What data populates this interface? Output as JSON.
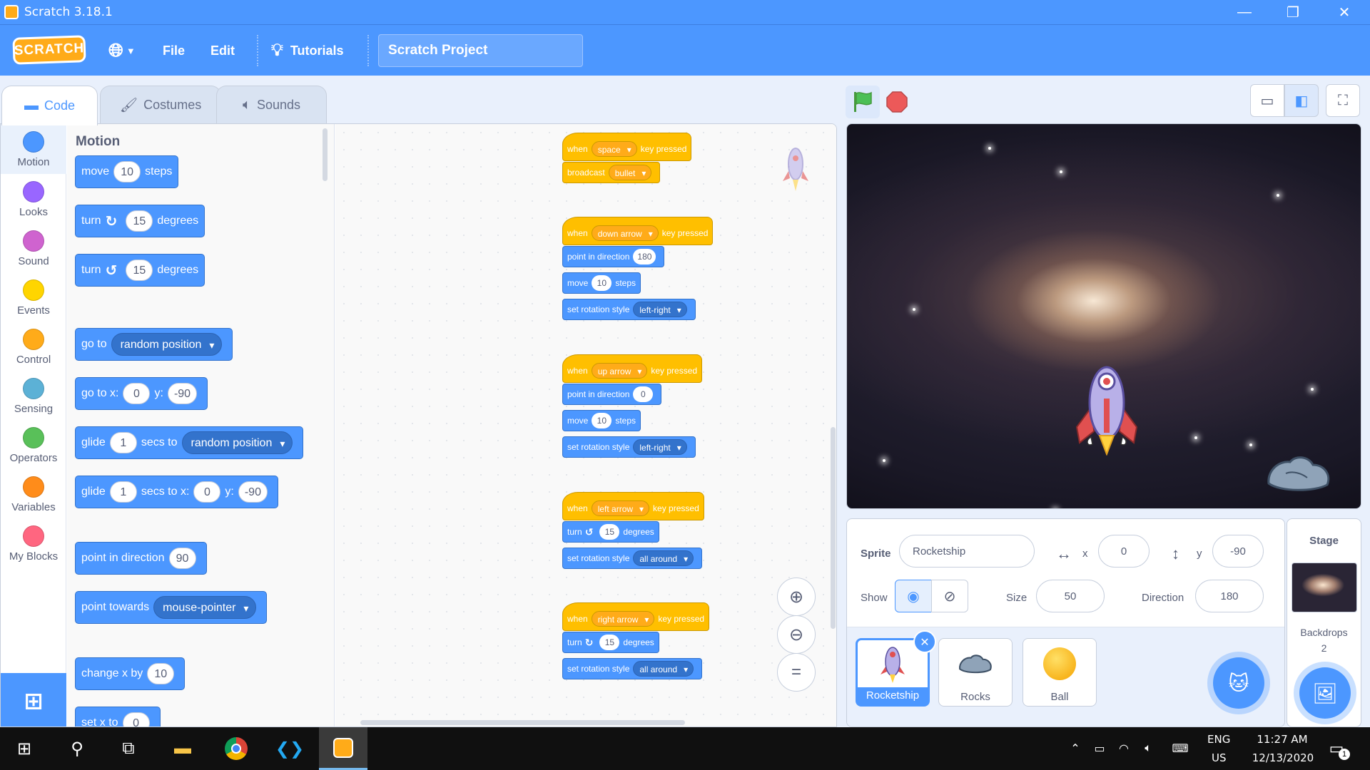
{
  "window": {
    "title": "Scratch 3.18.1"
  },
  "menubar": {
    "logo_text": "SCRATCH",
    "file": "File",
    "edit": "Edit",
    "tutorials": "Tutorials",
    "project_title": "Scratch Project"
  },
  "tabs": {
    "code": "Code",
    "costumes": "Costumes",
    "sounds": "Sounds"
  },
  "categories": [
    {
      "label": "Motion",
      "color": "#4c97ff"
    },
    {
      "label": "Looks",
      "color": "#9966ff"
    },
    {
      "label": "Sound",
      "color": "#cf63cf"
    },
    {
      "label": "Events",
      "color": "#ffd500"
    },
    {
      "label": "Control",
      "color": "#ffab19"
    },
    {
      "label": "Sensing",
      "color": "#5cb1d6"
    },
    {
      "label": "Operators",
      "color": "#59c059"
    },
    {
      "label": "Variables",
      "color": "#ff8c1a"
    },
    {
      "label": "My Blocks",
      "color": "#ff6680"
    }
  ],
  "palette": {
    "heading": "Motion",
    "move": {
      "a": "move",
      "v": "10",
      "b": "steps"
    },
    "turn_cw": {
      "a": "turn",
      "v": "15",
      "b": "degrees"
    },
    "turn_ccw": {
      "a": "turn",
      "v": "15",
      "b": "degrees"
    },
    "goto": {
      "a": "go to",
      "dd": "random position"
    },
    "goto_xy": {
      "a": "go to x:",
      "x": "0",
      "ylbl": "y:",
      "y": "-90"
    },
    "glide": {
      "a": "glide",
      "v": "1",
      "b": "secs to",
      "dd": "random position"
    },
    "glide_xy": {
      "a": "glide",
      "v": "1",
      "b": "secs to x:",
      "x": "0",
      "ylbl": "y:",
      "y": "-90"
    },
    "point_dir": {
      "a": "point in direction",
      "v": "90"
    },
    "point_towards": {
      "a": "point towards",
      "dd": "mouse-pointer"
    },
    "change_x": {
      "a": "change x by",
      "v": "10"
    },
    "set_x": {
      "a": "set x to",
      "v": "0"
    }
  },
  "scripts": {
    "s1": {
      "when": "when",
      "key": "space",
      "pressed": "key pressed",
      "broadcast": "broadcast",
      "msg": "bullet"
    },
    "s2": {
      "when": "when",
      "key": "down arrow",
      "pressed": "key pressed",
      "point": "point in direction",
      "dir": "180",
      "move": "move",
      "steps": "10",
      "steps_lbl": "steps",
      "rot": "set rotation style",
      "rot_val": "left-right"
    },
    "s3": {
      "when": "when",
      "key": "up arrow",
      "pressed": "key pressed",
      "point": "point in direction",
      "dir": "0",
      "move": "move",
      "steps": "10",
      "steps_lbl": "steps",
      "rot": "set rotation style",
      "rot_val": "left-right"
    },
    "s4": {
      "when": "when",
      "key": "left arrow",
      "pressed": "key pressed",
      "turn": "turn",
      "deg": "15",
      "deg_lbl": "degrees",
      "rot": "set rotation style",
      "rot_val": "all around"
    },
    "s5": {
      "when": "when",
      "key": "right arrow",
      "pressed": "key pressed",
      "turn": "turn",
      "deg": "15",
      "deg_lbl": "degrees",
      "rot": "set rotation style",
      "rot_val": "all around"
    }
  },
  "sprite_info": {
    "sprite_label": "Sprite",
    "sprite_name": "Rocketship",
    "x_label": "x",
    "x": "0",
    "y_label": "y",
    "y": "-90",
    "show_label": "Show",
    "size_label": "Size",
    "size": "50",
    "direction_label": "Direction",
    "direction": "180"
  },
  "sprites": [
    "Rocketship",
    "Rocks",
    "Ball"
  ],
  "stage_pane": {
    "title": "Stage",
    "backdrops_label": "Backdrops",
    "backdrops_count": "2"
  },
  "taskbar": {
    "lang1": "ENG",
    "lang2": "US",
    "time": "11:27 AM",
    "date": "12/13/2020",
    "notif_count": "1"
  }
}
